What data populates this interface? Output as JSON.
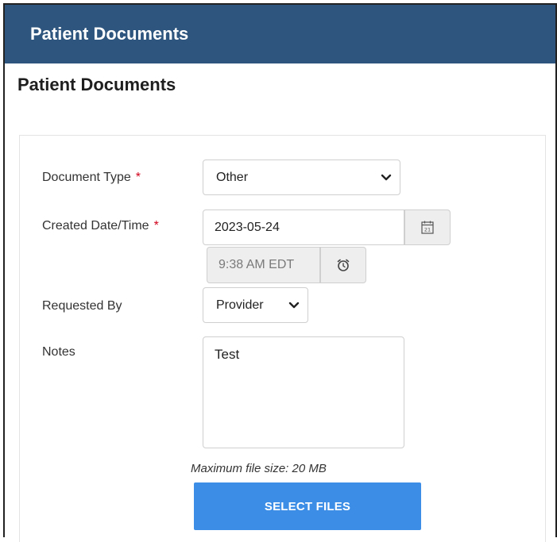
{
  "header": {
    "title": "Patient Documents"
  },
  "page": {
    "heading": "Patient Documents"
  },
  "form": {
    "document_type": {
      "label": "Document Type",
      "required_mark": "*",
      "value": "Other"
    },
    "created": {
      "label": "Created Date/Time",
      "required_mark": "*",
      "date_value": "2023-05-24",
      "time_value": "9:38 AM EDT"
    },
    "requested_by": {
      "label": "Requested By",
      "value": "Provider"
    },
    "notes": {
      "label": "Notes",
      "value": "Test"
    },
    "upload": {
      "hint": "Maximum file size: 20 MB",
      "button_label": "SELECT FILES"
    }
  },
  "icons": {
    "calendar": "calendar-icon",
    "clock": "alarm-clock-icon",
    "chevron": "chevron-down-icon"
  },
  "colors": {
    "header_bg": "#2e557e",
    "primary_button": "#3c8de6",
    "required": "#d0021b"
  }
}
